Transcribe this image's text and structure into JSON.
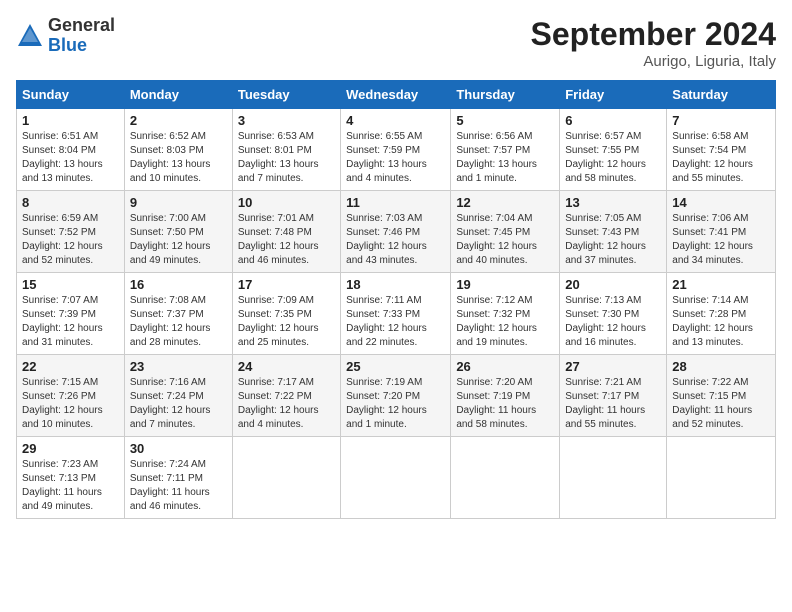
{
  "header": {
    "logo_general": "General",
    "logo_blue": "Blue",
    "month_title": "September 2024",
    "location": "Aurigo, Liguria, Italy"
  },
  "days_of_week": [
    "Sunday",
    "Monday",
    "Tuesday",
    "Wednesday",
    "Thursday",
    "Friday",
    "Saturday"
  ],
  "weeks": [
    [
      {
        "day": "1",
        "info": "Sunrise: 6:51 AM\nSunset: 8:04 PM\nDaylight: 13 hours\nand 13 minutes."
      },
      {
        "day": "2",
        "info": "Sunrise: 6:52 AM\nSunset: 8:03 PM\nDaylight: 13 hours\nand 10 minutes."
      },
      {
        "day": "3",
        "info": "Sunrise: 6:53 AM\nSunset: 8:01 PM\nDaylight: 13 hours\nand 7 minutes."
      },
      {
        "day": "4",
        "info": "Sunrise: 6:55 AM\nSunset: 7:59 PM\nDaylight: 13 hours\nand 4 minutes."
      },
      {
        "day": "5",
        "info": "Sunrise: 6:56 AM\nSunset: 7:57 PM\nDaylight: 13 hours\nand 1 minute."
      },
      {
        "day": "6",
        "info": "Sunrise: 6:57 AM\nSunset: 7:55 PM\nDaylight: 12 hours\nand 58 minutes."
      },
      {
        "day": "7",
        "info": "Sunrise: 6:58 AM\nSunset: 7:54 PM\nDaylight: 12 hours\nand 55 minutes."
      }
    ],
    [
      {
        "day": "8",
        "info": "Sunrise: 6:59 AM\nSunset: 7:52 PM\nDaylight: 12 hours\nand 52 minutes."
      },
      {
        "day": "9",
        "info": "Sunrise: 7:00 AM\nSunset: 7:50 PM\nDaylight: 12 hours\nand 49 minutes."
      },
      {
        "day": "10",
        "info": "Sunrise: 7:01 AM\nSunset: 7:48 PM\nDaylight: 12 hours\nand 46 minutes."
      },
      {
        "day": "11",
        "info": "Sunrise: 7:03 AM\nSunset: 7:46 PM\nDaylight: 12 hours\nand 43 minutes."
      },
      {
        "day": "12",
        "info": "Sunrise: 7:04 AM\nSunset: 7:45 PM\nDaylight: 12 hours\nand 40 minutes."
      },
      {
        "day": "13",
        "info": "Sunrise: 7:05 AM\nSunset: 7:43 PM\nDaylight: 12 hours\nand 37 minutes."
      },
      {
        "day": "14",
        "info": "Sunrise: 7:06 AM\nSunset: 7:41 PM\nDaylight: 12 hours\nand 34 minutes."
      }
    ],
    [
      {
        "day": "15",
        "info": "Sunrise: 7:07 AM\nSunset: 7:39 PM\nDaylight: 12 hours\nand 31 minutes."
      },
      {
        "day": "16",
        "info": "Sunrise: 7:08 AM\nSunset: 7:37 PM\nDaylight: 12 hours\nand 28 minutes."
      },
      {
        "day": "17",
        "info": "Sunrise: 7:09 AM\nSunset: 7:35 PM\nDaylight: 12 hours\nand 25 minutes."
      },
      {
        "day": "18",
        "info": "Sunrise: 7:11 AM\nSunset: 7:33 PM\nDaylight: 12 hours\nand 22 minutes."
      },
      {
        "day": "19",
        "info": "Sunrise: 7:12 AM\nSunset: 7:32 PM\nDaylight: 12 hours\nand 19 minutes."
      },
      {
        "day": "20",
        "info": "Sunrise: 7:13 AM\nSunset: 7:30 PM\nDaylight: 12 hours\nand 16 minutes."
      },
      {
        "day": "21",
        "info": "Sunrise: 7:14 AM\nSunset: 7:28 PM\nDaylight: 12 hours\nand 13 minutes."
      }
    ],
    [
      {
        "day": "22",
        "info": "Sunrise: 7:15 AM\nSunset: 7:26 PM\nDaylight: 12 hours\nand 10 minutes."
      },
      {
        "day": "23",
        "info": "Sunrise: 7:16 AM\nSunset: 7:24 PM\nDaylight: 12 hours\nand 7 minutes."
      },
      {
        "day": "24",
        "info": "Sunrise: 7:17 AM\nSunset: 7:22 PM\nDaylight: 12 hours\nand 4 minutes."
      },
      {
        "day": "25",
        "info": "Sunrise: 7:19 AM\nSunset: 7:20 PM\nDaylight: 12 hours\nand 1 minute."
      },
      {
        "day": "26",
        "info": "Sunrise: 7:20 AM\nSunset: 7:19 PM\nDaylight: 11 hours\nand 58 minutes."
      },
      {
        "day": "27",
        "info": "Sunrise: 7:21 AM\nSunset: 7:17 PM\nDaylight: 11 hours\nand 55 minutes."
      },
      {
        "day": "28",
        "info": "Sunrise: 7:22 AM\nSunset: 7:15 PM\nDaylight: 11 hours\nand 52 minutes."
      }
    ],
    [
      {
        "day": "29",
        "info": "Sunrise: 7:23 AM\nSunset: 7:13 PM\nDaylight: 11 hours\nand 49 minutes."
      },
      {
        "day": "30",
        "info": "Sunrise: 7:24 AM\nSunset: 7:11 PM\nDaylight: 11 hours\nand 46 minutes."
      },
      {
        "day": "",
        "info": ""
      },
      {
        "day": "",
        "info": ""
      },
      {
        "day": "",
        "info": ""
      },
      {
        "day": "",
        "info": ""
      },
      {
        "day": "",
        "info": ""
      }
    ]
  ]
}
